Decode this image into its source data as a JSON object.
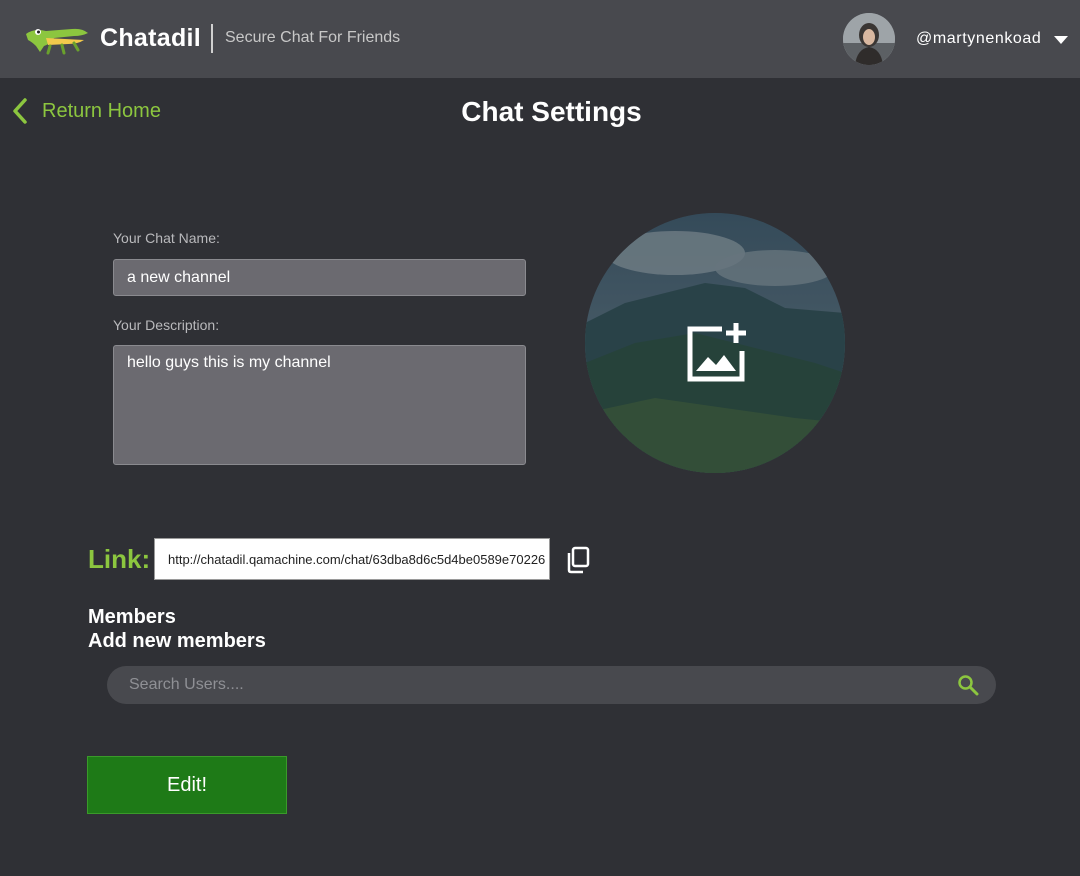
{
  "header": {
    "brand": "Chatadil",
    "tagline": "Secure Chat For Friends",
    "username": "@martynenkoad",
    "user_menu_icon": "caret-down-icon",
    "logo_icon": "crocodile-logo-icon"
  },
  "nav": {
    "return_label": "Return Home",
    "return_icon": "chevron-left-icon"
  },
  "page": {
    "title": "Chat Settings"
  },
  "form": {
    "name_label": "Your Chat Name:",
    "name_value": "a new channel",
    "description_label": "Your Description:",
    "description_value": "hello guys this is my channel",
    "image_icon": "add-image-icon"
  },
  "link": {
    "label": "Link:",
    "url": "http://chatadil.qamachine.com/chat/63dba8d6c5d4be0589e70226",
    "copy_icon": "copy-icon"
  },
  "members": {
    "title": "Members",
    "add_title": "Add new members",
    "search_placeholder": "Search Users....",
    "search_icon": "search-icon"
  },
  "actions": {
    "edit_label": "Edit!"
  },
  "colors": {
    "background": "#2f3035",
    "header": "#48494e",
    "accent": "#8cc63f",
    "button": "#1e7a17",
    "input": "#6b6a70"
  }
}
